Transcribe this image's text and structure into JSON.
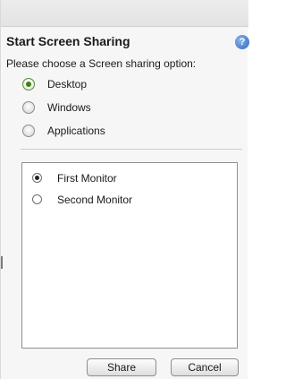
{
  "dialog": {
    "title": "Start Screen Sharing",
    "help_icon": "help-icon",
    "prompt": "Please choose a Screen sharing option:"
  },
  "sharing_options": [
    {
      "label": "Desktop",
      "selected": true
    },
    {
      "label": "Windows",
      "selected": false
    },
    {
      "label": "Applications",
      "selected": false
    }
  ],
  "monitors": [
    {
      "label": "First Monitor",
      "selected": true
    },
    {
      "label": "Second Monitor",
      "selected": false
    }
  ],
  "buttons": {
    "share_label": "Share",
    "cancel_label": "Cancel"
  },
  "colors": {
    "help_icon_blue": "#2f68c2",
    "selected_radio_green": "#3f7f1b"
  }
}
